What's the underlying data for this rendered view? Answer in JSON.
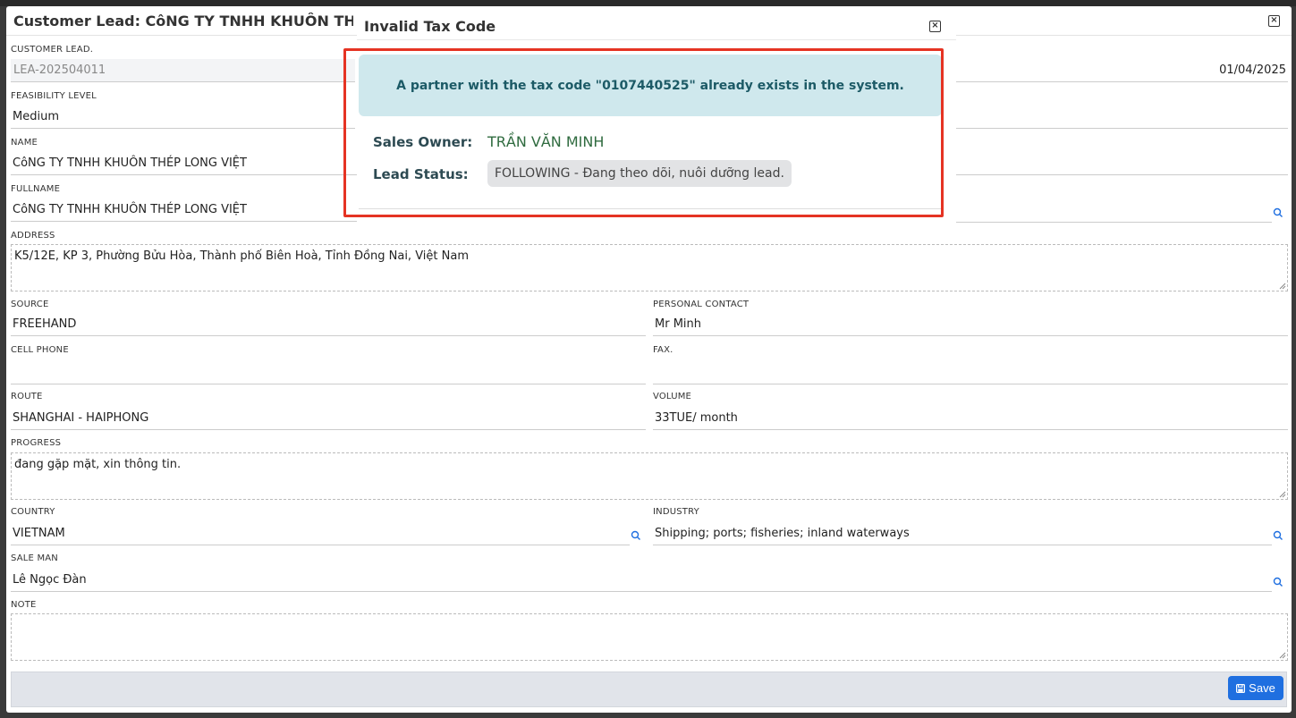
{
  "modal": {
    "title": "Customer Lead: CôNG TY TNHH KHUÔN THÉP LONG VIỆT",
    "fields": {
      "customer_lead": {
        "label": "CUSTOMER LEAD.",
        "value": "LEA-202504011"
      },
      "date": {
        "value": "01/04/2025"
      },
      "feasibility": {
        "label": "FEASIBILITY LEVEL",
        "value": "Medium"
      },
      "name": {
        "label": "NAME",
        "value": "CôNG TY TNHH KHUÔN THÉP LONG VIỆT"
      },
      "fullname": {
        "label": "FULLNAME",
        "value": "CôNG TY TNHH KHUÔN THÉP LONG VIỆT"
      },
      "address": {
        "label": "ADDRESS",
        "value": "K5/12E, KP 3, Phường Bửu Hòa, Thành phố Biên Hoà, Tỉnh Đồng Nai, Việt Nam"
      },
      "source": {
        "label": "SOURCE",
        "value": "FREEHAND"
      },
      "personal_contact": {
        "label": "PERSONAL CONTACT",
        "value": "Mr Minh"
      },
      "cell_phone": {
        "label": "CELL PHONE",
        "value": ""
      },
      "fax": {
        "label": "FAX.",
        "value": ""
      },
      "route": {
        "label": "ROUTE",
        "value": "SHANGHAI - HAIPHONG"
      },
      "volume": {
        "label": "VOLUME",
        "value": "33TUE/ month"
      },
      "progress": {
        "label": "PROGRESS",
        "value": "đang gặp mặt, xin thông tin."
      },
      "country": {
        "label": "COUNTRY",
        "value": "VIETNAM"
      },
      "industry": {
        "label": "INDUSTRY",
        "value": "Shipping; ports; fisheries; inland waterways"
      },
      "sale_man": {
        "label": "SALE MAN",
        "value": "Lê Ngọc Đàn"
      },
      "note": {
        "label": "NOTE",
        "value": ""
      }
    },
    "save_label": "Save"
  },
  "dialog": {
    "title": "Invalid Tax Code",
    "message": "A partner with the tax code \"0107440525\" already exists in the system.",
    "sales_owner_label": "Sales Owner:",
    "sales_owner_value": "TRẦN VĂN MINH",
    "lead_status_label": "Lead Status:",
    "lead_status_value": "FOLLOWING - Đang theo dõi, nuôi dưỡng lead."
  },
  "colors": {
    "highlight_border": "#e53323",
    "alert_bg": "#cfe8ed",
    "save_button": "#1f6fe0"
  }
}
